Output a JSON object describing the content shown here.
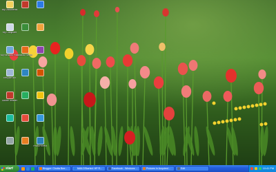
{
  "desktop": {
    "icons": [
      {
        "label": "My Documents",
        "color": "#f2d15c"
      },
      {
        "label": "",
        "color": "#c0392b"
      },
      {
        "label": "",
        "color": "#2c7be5"
      },
      {
        "label": "My Computer",
        "color": "#cfd8e6"
      },
      {
        "label": "",
        "color": "#3a8d3a"
      },
      {
        "label": "",
        "color": "#f2a33c"
      },
      {
        "label": "My Network Places",
        "color": "#6fa8dc"
      },
      {
        "label": "Mozilla Firefox",
        "color": "#e66a1a"
      },
      {
        "label": "",
        "color": "#8e44ad"
      },
      {
        "label": "Recycle Bin",
        "color": "#9fb7d6"
      },
      {
        "label": "",
        "color": "#2e86c1"
      },
      {
        "label": "",
        "color": "#d35400"
      },
      {
        "label": "Adobe Reader",
        "color": "#c0392b"
      },
      {
        "label": "",
        "color": "#27ae60"
      },
      {
        "label": "",
        "color": "#f1c40f"
      },
      {
        "label": "",
        "color": "#1abc9c"
      },
      {
        "label": "",
        "color": "#e74c3c"
      },
      {
        "label": "",
        "color": "#3498db"
      },
      {
        "label": "",
        "color": "#95a5a6"
      },
      {
        "label": "",
        "color": "#e67e22"
      },
      {
        "label": "PhotoPerfect",
        "color": "#2980b9"
      }
    ]
  },
  "taskbar": {
    "start_label": "start",
    "quicklaunch_colors": [
      "#f39c12",
      "#2e86de",
      "#27ae60"
    ],
    "tasks": [
      {
        "label": "Blogger: Chotta Bee...",
        "color": "#f57d00"
      },
      {
        "label": "MAILDStarted: HP R...",
        "color": "#2c7be5"
      },
      {
        "label": "Facebook - Windows ...",
        "color": "#3b5998"
      },
      {
        "label": "Pictures in Acquired...",
        "color": "#e67e22"
      },
      {
        "label": "Edit",
        "color": "#5d6d7e"
      }
    ],
    "tray_icon_colors": [
      "#e74c3c",
      "#f1c40f",
      "#2ecc71"
    ],
    "clock": "10:41 PM"
  }
}
